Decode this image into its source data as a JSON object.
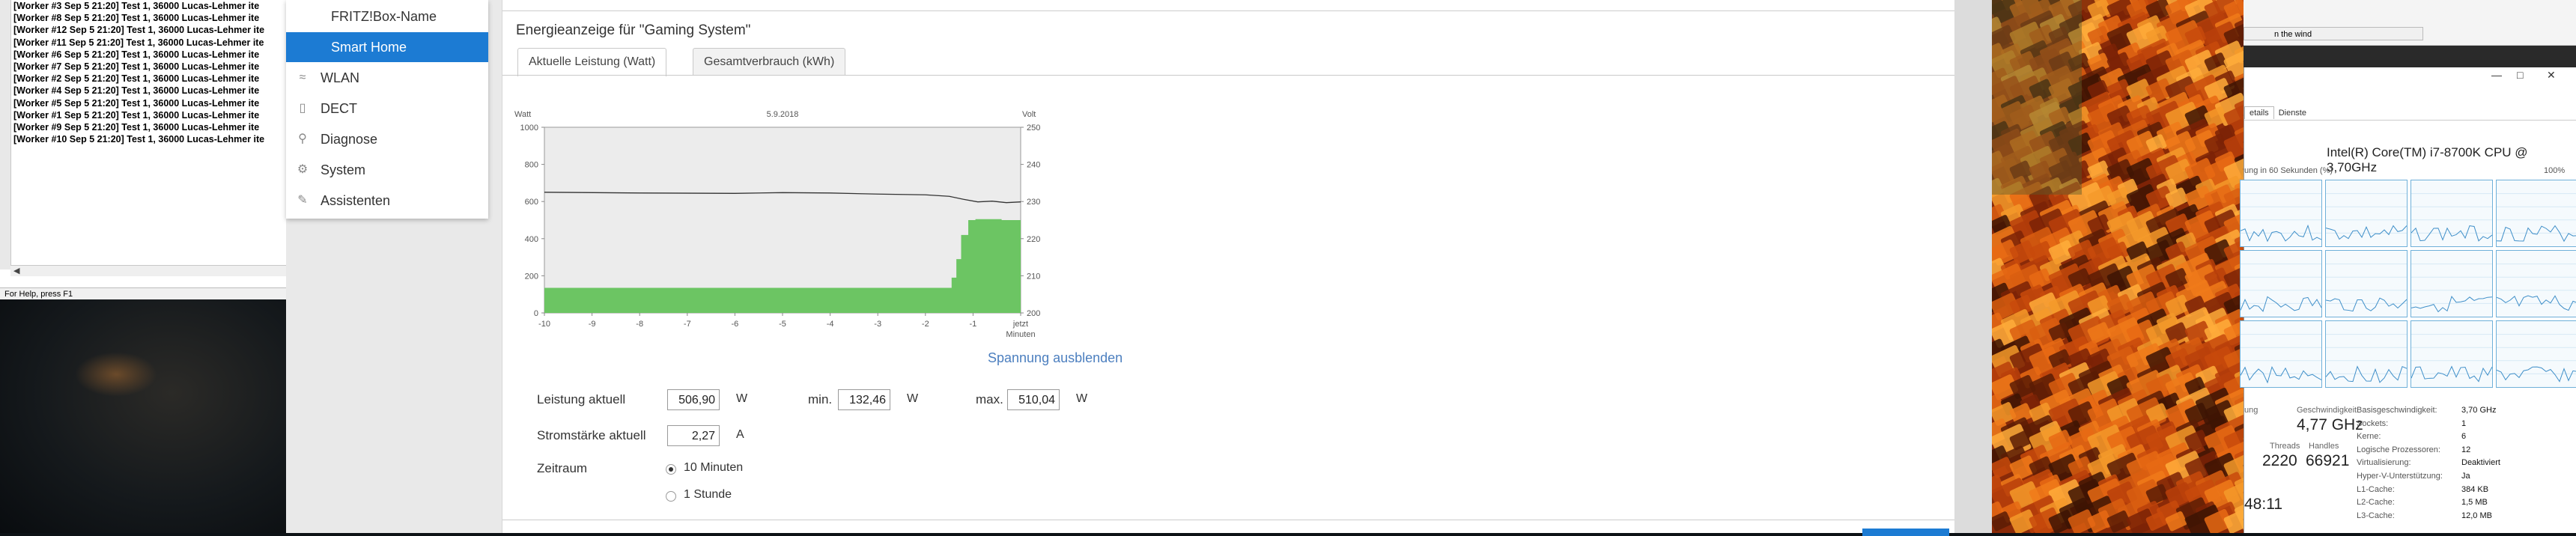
{
  "console": {
    "lines": [
      "[Worker #3 Sep 5 21:20] Test 1, 36000 Lucas-Lehmer ite",
      "[Worker #8 Sep 5 21:20] Test 1, 36000 Lucas-Lehmer ite",
      "[Worker #12 Sep 5 21:20] Test 1, 36000 Lucas-Lehmer ite",
      "[Worker #11 Sep 5 21:20] Test 1, 36000 Lucas-Lehmer ite",
      "[Worker #6 Sep 5 21:20] Test 1, 36000 Lucas-Lehmer ite",
      "[Worker #7 Sep 5 21:20] Test 1, 36000 Lucas-Lehmer ite",
      "[Worker #2 Sep 5 21:20] Test 1, 36000 Lucas-Lehmer ite",
      "[Worker #4 Sep 5 21:20] Test 1, 36000 Lucas-Lehmer ite",
      "[Worker #5 Sep 5 21:20] Test 1, 36000 Lucas-Lehmer ite",
      "[Worker #1 Sep 5 21:20] Test 1, 36000 Lucas-Lehmer ite",
      "[Worker #9 Sep 5 21:20] Test 1, 36000 Lucas-Lehmer ite",
      "[Worker #10 Sep 5 21:20] Test 1, 36000 Lucas-Lehmer ite"
    ],
    "status": "For Help, press F1"
  },
  "menu": {
    "items": [
      {
        "label": "FRITZ!Box-Name",
        "icon": "none",
        "sub": true,
        "active": false
      },
      {
        "label": "Smart Home",
        "icon": "none",
        "sub": true,
        "active": true
      },
      {
        "label": "WLAN",
        "icon": "wifi-icon",
        "sub": false,
        "active": false
      },
      {
        "label": "DECT",
        "icon": "phone-icon",
        "sub": false,
        "active": false
      },
      {
        "label": "Diagnose",
        "icon": "magnifier-icon",
        "sub": false,
        "active": false
      },
      {
        "label": "System",
        "icon": "gear-icon",
        "sub": false,
        "active": false
      },
      {
        "label": "Assistenten",
        "icon": "wand-icon",
        "sub": false,
        "active": false
      }
    ]
  },
  "fritz": {
    "title": "Energieanzeige für \"Gaming System\"",
    "tabs": [
      "Aktuelle Leistung (Watt)",
      "Gesamtverbrauch (kWh)"
    ],
    "toggle_link": "Spannung ausblenden",
    "form": {
      "power_label": "Leistung aktuell",
      "power_value": "506,90",
      "power_unit": "W",
      "min_label": "min.",
      "min_value": "132,46",
      "min_unit": "W",
      "max_label": "max.",
      "max_value": "510,04",
      "max_unit": "W",
      "current_label": "Stromstärke aktuell",
      "current_value": "2,27",
      "current_unit": "A",
      "period_label": "Zeitraum",
      "period_options": [
        "10 Minuten",
        "1 Stunde"
      ],
      "period_selected": 0
    }
  },
  "chart_data": {
    "type": "area",
    "title": "5.9.2018",
    "ylabel": "Watt",
    "y2label": "Volt",
    "xlabel": "Minuten",
    "xlim": [
      -10,
      0
    ],
    "ylim": [
      0,
      1000
    ],
    "y2lim": [
      200,
      250
    ],
    "x_ticks": [
      "-10",
      "-9",
      "-8",
      "-7",
      "-6",
      "-5",
      "-4",
      "-3",
      "-2",
      "-1",
      "jetzt"
    ],
    "y_ticks": [
      0,
      200,
      400,
      600,
      800,
      1000
    ],
    "y2_ticks": [
      200,
      210,
      220,
      230,
      240,
      250
    ],
    "grid": false,
    "series": [
      {
        "name": "Watt",
        "color": "#6cc563",
        "x": [
          -10,
          -1.55,
          -1.45,
          -1.35,
          -1.25,
          -1.1,
          -0.95,
          -0.7,
          -0.4,
          0
        ],
        "y": [
          135,
          135,
          190,
          290,
          420,
          500,
          505,
          505,
          500,
          510
        ]
      },
      {
        "name": "Volt",
        "color": "#333333",
        "x": [
          -10,
          -8,
          -6,
          -5,
          -4,
          -3,
          -2,
          -1.5,
          -1.2,
          -0.9,
          -0.6,
          -0.3,
          0
        ],
        "y": [
          232.5,
          232.3,
          232.2,
          232.4,
          232.3,
          232.0,
          231.8,
          231.4,
          230.6,
          229.9,
          230.1,
          229.7,
          229.9
        ]
      }
    ]
  },
  "taskmanager": {
    "top_window_text": "n the wind",
    "tabs": [
      "etails",
      "Dienste"
    ],
    "cpu_name": "Intel(R) Core(TM) i7-8700K CPU @ 3,70GHz",
    "util_caption": "ung in 60 Sekunden (%)",
    "util_max": "100%",
    "speed_label": "Geschwindigkeit",
    "speed_value": "4,77 GHz",
    "util_label": "ung",
    "threads_label": "Threads",
    "threads_value": "2220",
    "handles_label": "Handles",
    "handles_value": "66921",
    "uptime_value": "48:11",
    "info": [
      {
        "k": "Basisgeschwindigkeit:",
        "v": "3,70 GHz"
      },
      {
        "k": "Sockets:",
        "v": "1"
      },
      {
        "k": "Kerne:",
        "v": "6"
      },
      {
        "k": "Logische Prozessoren:",
        "v": "12"
      },
      {
        "k": "Virtualisierung:",
        "v": "Deaktiviert"
      },
      {
        "k": "Hyper-V-Unterstützung:",
        "v": "Ja"
      },
      {
        "k": "L1-Cache:",
        "v": "384 KB"
      },
      {
        "k": "L2-Cache:",
        "v": "1,5 MB"
      },
      {
        "k": "L3-Cache:",
        "v": "12,0 MB"
      }
    ]
  }
}
